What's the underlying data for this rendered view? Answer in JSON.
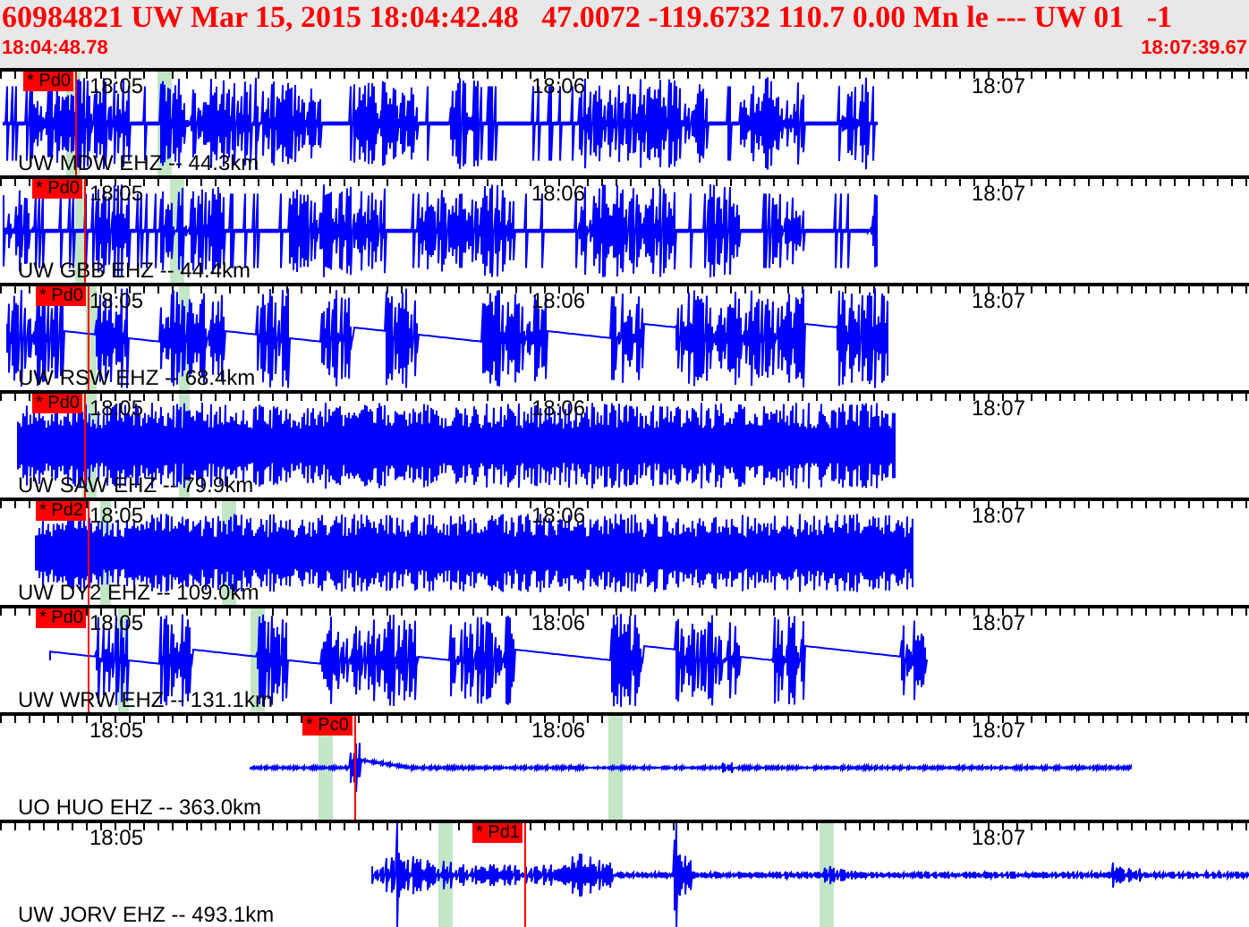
{
  "header": {
    "event": "60984821 UW Mar 15, 2015 18:04:42.48   47.0072 -119.6732 110.7 0.00 Mn le --- UW 01   -1",
    "start_time": "18:04:48.78",
    "end_time": "18:07:39.67"
  },
  "traces": [
    {
      "station": "UW MDW EHZ -- 44.3km",
      "pick": "* Pd0",
      "time_labels": [
        "18:05",
        "18:06",
        "18:07"
      ]
    },
    {
      "station": "UW GBB EHZ -- 44.4km",
      "pick": "* Pd0",
      "time_labels": [
        "18:05",
        "18:06",
        "18:07"
      ]
    },
    {
      "station": "UW RSW EHZ -- 68.4km",
      "pick": "* Pd0",
      "time_labels": [
        "18:05",
        "18:06",
        "18:07"
      ]
    },
    {
      "station": "UW SAW EHZ -- 79.9km",
      "pick": "* Pd0",
      "time_labels": [
        "18:05",
        "18:06",
        "18:07"
      ]
    },
    {
      "station": "UW DY2 EHZ -- 109.0km",
      "pick": "* Pd2",
      "time_labels": [
        "18:05",
        "18:06",
        "18:07"
      ]
    },
    {
      "station": "UW WRW EHZ -- 131.1km",
      "pick": "* Pd0",
      "time_labels": [
        "18:05",
        "18:06",
        "18:07"
      ]
    },
    {
      "station": "UO HUO EHZ -- 363.0km",
      "pick": "* Pc0",
      "time_labels": [
        "18:05",
        "18:06",
        "18:07"
      ]
    },
    {
      "station": "UW JORV EHZ -- 493.1km",
      "pick": "* Pd1",
      "time_labels": [
        "18:05",
        "18:07"
      ]
    }
  ]
}
